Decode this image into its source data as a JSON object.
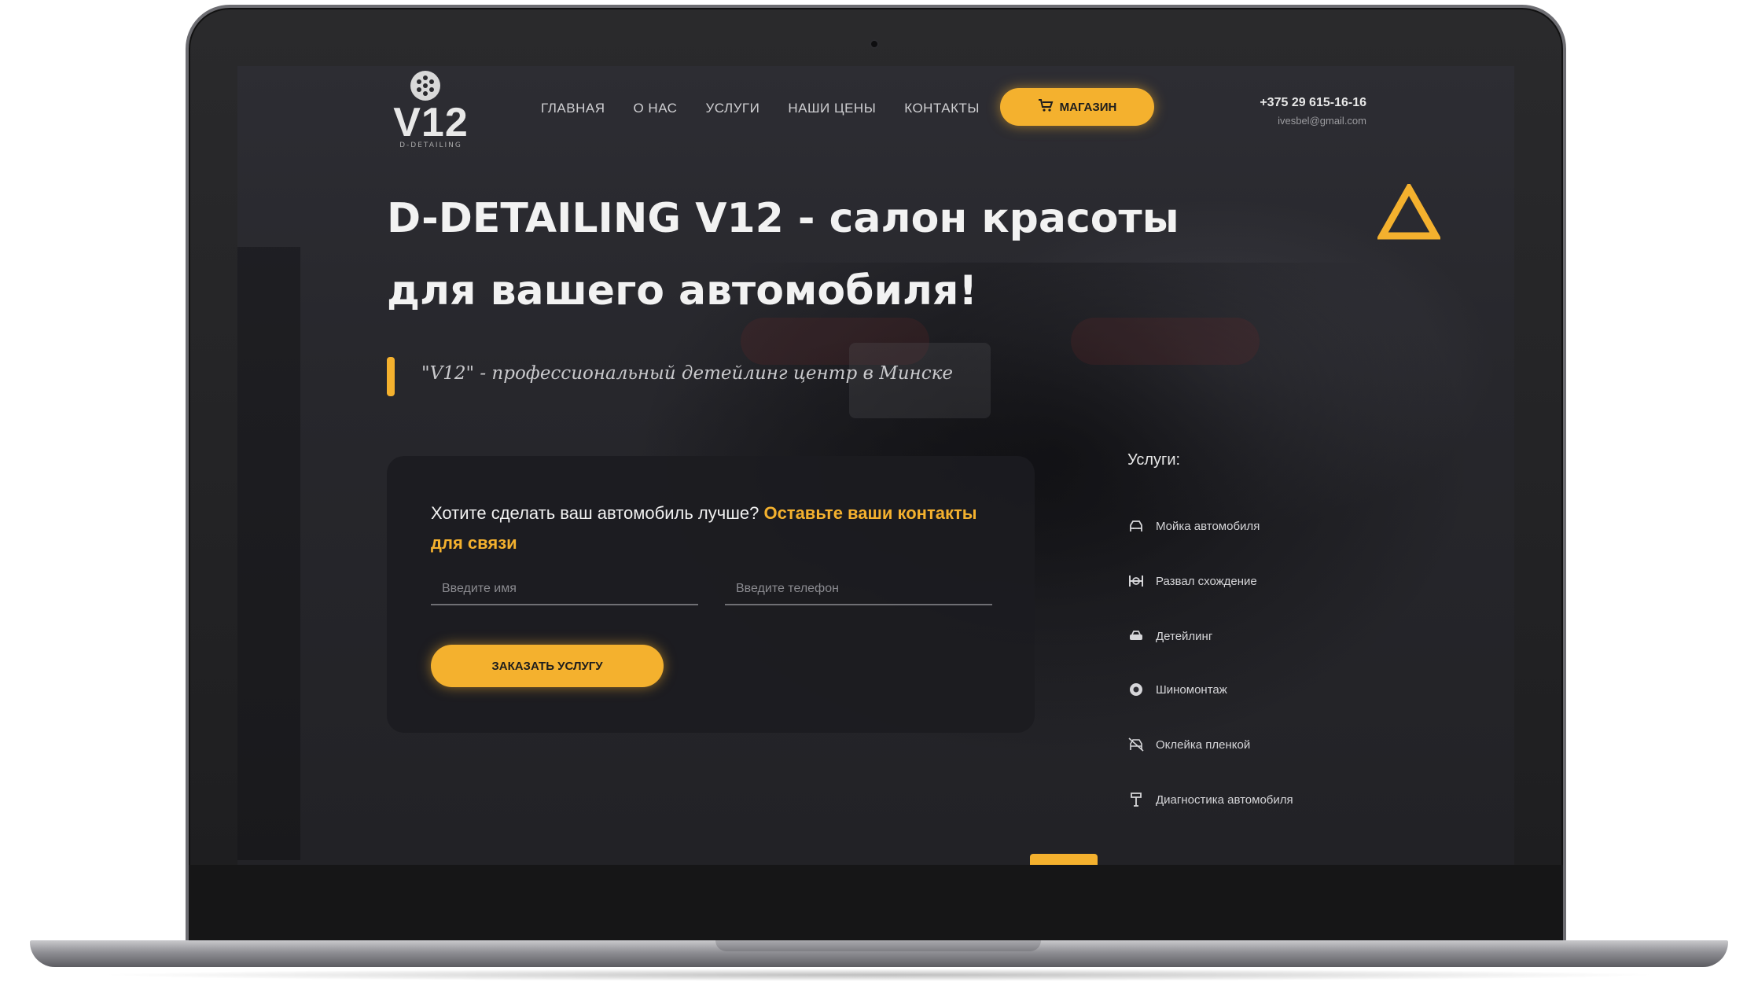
{
  "header": {
    "logo_text": "V12",
    "logo_subtitle": "D-DETAILING",
    "nav": [
      "ГЛАВНАЯ",
      "О НАС",
      "УСЛУГИ",
      "НАШИ ЦЕНЫ",
      "КОНТАКТЫ"
    ],
    "shop_label": "МАГАЗИН",
    "phone": "+375 29 615-16-16",
    "email": "ivesbel@gmail.com"
  },
  "hero": {
    "title": "D-DETAILING V12 - салон красоты для вашего автомобиля!",
    "subtitle": "\"V12\" - профессиональный детейлинг центр в Минске"
  },
  "form": {
    "question": "Хотите сделать ваш автомобиль лучше?",
    "question_highlight": "Оставьте ваши контакты для связи",
    "name_placeholder": "Введите имя",
    "phone_placeholder": "Введите телефон",
    "submit_label": "ЗАКАЗАТЬ УСЛУГУ"
  },
  "services": {
    "title": "Услуги:",
    "items": [
      {
        "label": "Мойка автомобиля",
        "icon": "car-wash-icon"
      },
      {
        "label": "Развал схождение",
        "icon": "wheel-alignment-icon"
      },
      {
        "label": "Детейлинг",
        "icon": "car-icon"
      },
      {
        "label": "Шиномонтаж",
        "icon": "tire-icon"
      },
      {
        "label": "Оклейка пленкой",
        "icon": "film-wrap-icon"
      },
      {
        "label": "Диагностика автомобиля",
        "icon": "diagnostics-icon"
      }
    ]
  },
  "colors": {
    "accent": "#f4b12e",
    "background": "#27272c",
    "card": "#1c1c20",
    "text": "#f2f2f2"
  }
}
